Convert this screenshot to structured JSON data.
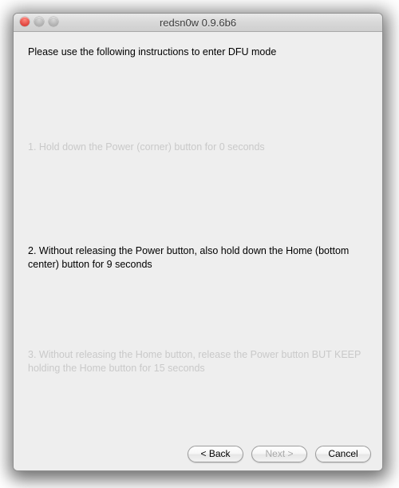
{
  "window": {
    "title": "redsn0w 0.9.6b6"
  },
  "content": {
    "heading": "Please use the following instructions to enter DFU mode",
    "step1": "1. Hold down the Power (corner) button for 0 seconds",
    "step2": "2. Without releasing the Power button, also hold down the Home (bottom center) button for 9 seconds",
    "step3": "3. Without releasing the Home button, release the Power button BUT KEEP holding the Home button for 15 seconds"
  },
  "footer": {
    "back_label": "< Back",
    "next_label": "Next >",
    "cancel_label": "Cancel"
  }
}
